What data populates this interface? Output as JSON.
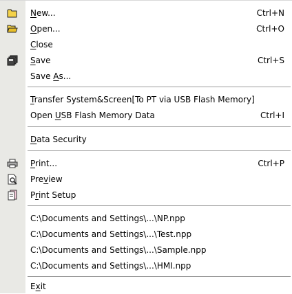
{
  "menu": {
    "items": {
      "new": {
        "pre": "",
        "key": "N",
        "post": "ew...",
        "shortcut": "Ctrl+N",
        "icon": "folder-new-icon"
      },
      "open": {
        "pre": "",
        "key": "O",
        "post": "pen...",
        "shortcut": "Ctrl+O",
        "icon": "folder-open-icon"
      },
      "close": {
        "pre": "",
        "key": "C",
        "post": "lose"
      },
      "save": {
        "pre": "",
        "key": "S",
        "post": "ave",
        "shortcut": "Ctrl+S",
        "icon": "save-icon"
      },
      "save_as": {
        "pre": "Save ",
        "key": "A",
        "post": "s..."
      },
      "transfer": {
        "pre": "",
        "key": "T",
        "post": "ransfer System&Screen[To PT via USB Flash Memory]"
      },
      "open_usb": {
        "pre": "Open ",
        "key": "U",
        "post": "SB Flash Memory Data",
        "shortcut": "Ctrl+I"
      },
      "data_security": {
        "pre": "",
        "key": "D",
        "post": "ata Security"
      },
      "print": {
        "pre": "",
        "key": "P",
        "post": "rint...",
        "shortcut": "Ctrl+P",
        "icon": "printer-icon"
      },
      "preview": {
        "pre": "Pre",
        "key": "v",
        "post": "iew",
        "icon": "print-preview-icon"
      },
      "print_setup": {
        "pre": "P",
        "key": "r",
        "post": "int Setup",
        "icon": "print-setup-icon"
      },
      "recent1": {
        "label": "C:\\Documents and Settings\\...\\NP.npp"
      },
      "recent2": {
        "label": "C:\\Documents and Settings\\...\\Test.npp"
      },
      "recent3": {
        "label": "C:\\Documents and Settings\\...\\Sample.npp"
      },
      "recent4": {
        "label": "C:\\Documents and Settings\\...\\HMI.npp"
      },
      "exit": {
        "pre": "E",
        "key": "x",
        "post": "it"
      }
    }
  },
  "colors": {
    "gutter": "#e9e9e5",
    "separator": "#9a9a9a",
    "icon_yellow": "#f4d24a"
  }
}
